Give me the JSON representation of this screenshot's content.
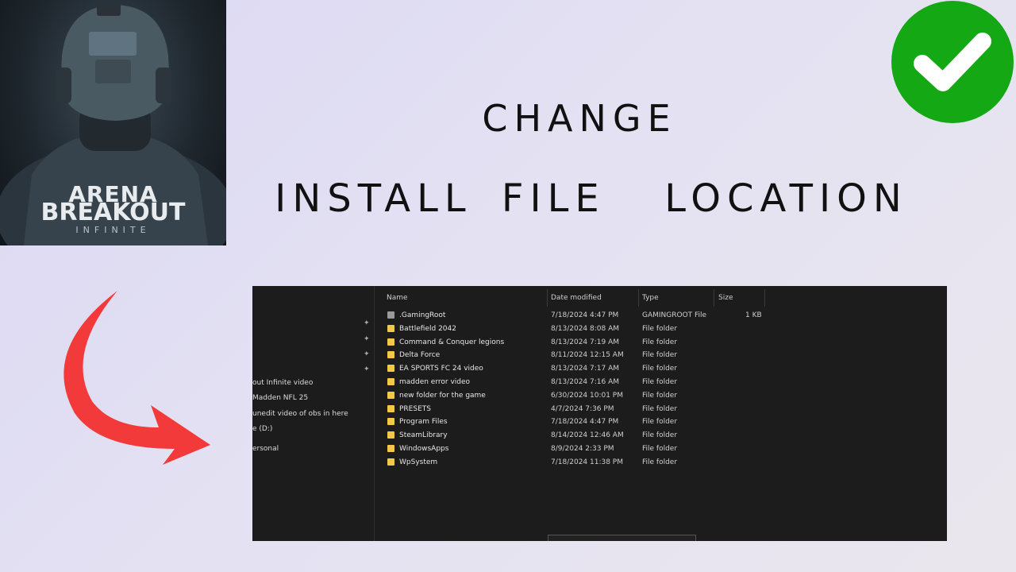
{
  "logo": {
    "line1": "ARENA",
    "line2": "BREAKOUT",
    "line3": "INFINITE"
  },
  "heading": {
    "line1": "CHANGE",
    "line2": "INSTALL FILE  LOCATION"
  },
  "colors": {
    "check": "#14a814",
    "arrow": "#f23a3a",
    "folder": "#f2c84b"
  },
  "explorer": {
    "nav_items": [
      "out Infinite video",
      "Madden NFL 25",
      "unedit video of obs in here",
      "e (D:)",
      "ersonal"
    ],
    "columns": {
      "name": "Name",
      "date": "Date modified",
      "type": "Type",
      "size": "Size"
    },
    "rows": [
      {
        "name": ".GamingRoot",
        "date": "7/18/2024 4:47 PM",
        "type": "GAMINGROOT File",
        "size": "1 KB",
        "icon": "file-icon"
      },
      {
        "name": "Battlefield 2042",
        "date": "8/13/2024 8:08 AM",
        "type": "File folder",
        "size": "",
        "icon": "folder-icon"
      },
      {
        "name": "Command & Conquer legions",
        "date": "8/13/2024 7:19 AM",
        "type": "File folder",
        "size": "",
        "icon": "folder-icon"
      },
      {
        "name": "Delta Force",
        "date": "8/11/2024 12:15 AM",
        "type": "File folder",
        "size": "",
        "icon": "folder-icon"
      },
      {
        "name": "EA SPORTS FC 24 video",
        "date": "8/13/2024 7:17 AM",
        "type": "File folder",
        "size": "",
        "icon": "folder-icon"
      },
      {
        "name": "madden error video",
        "date": "8/13/2024 7:16 AM",
        "type": "File folder",
        "size": "",
        "icon": "folder-icon"
      },
      {
        "name": "new folder for the game",
        "date": "6/30/2024 10:01 PM",
        "type": "File folder",
        "size": "",
        "icon": "folder-icon"
      },
      {
        "name": "PRESETS",
        "date": "4/7/2024 7:36 PM",
        "type": "File folder",
        "size": "",
        "icon": "folder-icon"
      },
      {
        "name": "Program Files",
        "date": "7/18/2024 4:47 PM",
        "type": "File folder",
        "size": "",
        "icon": "folder-icon"
      },
      {
        "name": "SteamLibrary",
        "date": "8/14/2024 12:46 AM",
        "type": "File folder",
        "size": "",
        "icon": "folder-icon"
      },
      {
        "name": "WindowsApps",
        "date": "8/9/2024 2:33 PM",
        "type": "File folder",
        "size": "",
        "icon": "folder-icon"
      },
      {
        "name": "WpSystem",
        "date": "7/18/2024 11:38 PM",
        "type": "File folder",
        "size": "",
        "icon": "folder-icon"
      }
    ]
  }
}
